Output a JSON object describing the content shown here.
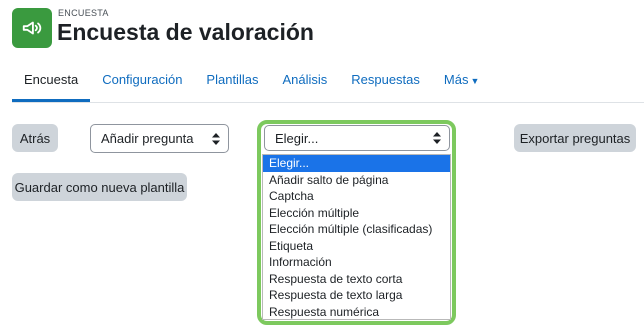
{
  "header": {
    "module_type": "ENCUESTA",
    "title": "Encuesta de valoración",
    "module_icon": "megaphone-icon",
    "accent_color": "#3a9a3f"
  },
  "tabs": [
    {
      "label": "Encuesta",
      "active": true
    },
    {
      "label": "Configuración",
      "active": false
    },
    {
      "label": "Plantillas",
      "active": false
    },
    {
      "label": "Análisis",
      "active": false
    },
    {
      "label": "Respuestas",
      "active": false
    },
    {
      "label": "Más",
      "active": false
    }
  ],
  "toolbar": {
    "back_label": "Atrás",
    "add_question_value": "Añadir pregunta",
    "choose_value": "Elegir...",
    "export_label": "Exportar preguntas",
    "save_template_label": "Guardar como nueva plantilla"
  },
  "dropdown": {
    "highlight_color": "#7dc95e",
    "selected_color": "#1a73e8",
    "options": [
      "Elegir...",
      "Añadir salto de página",
      "Captcha",
      "Elección múltiple",
      "Elección múltiple (clasificadas)",
      "Etiqueta",
      "Información",
      "Respuesta de texto corta",
      "Respuesta de texto larga",
      "Respuesta numérica"
    ]
  }
}
